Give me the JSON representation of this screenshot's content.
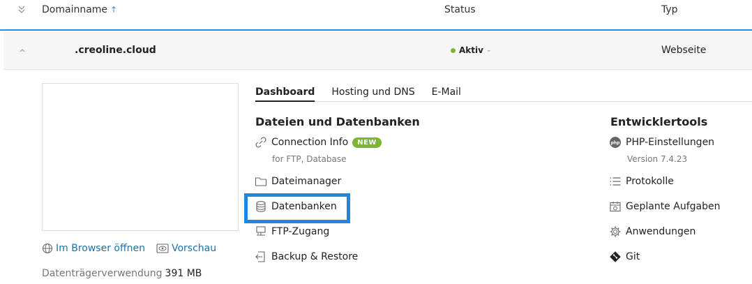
{
  "table": {
    "headers": {
      "domain": "Domainname",
      "status": "Status",
      "type": "Typ"
    }
  },
  "domain_row": {
    "name": ".creoline.cloud",
    "status": "Aktiv",
    "type": "Webseite"
  },
  "preview": {
    "open_browser": "Im Browser öffnen",
    "preview": "Vorschau",
    "disk_usage_label": "Datenträgerverwendung",
    "disk_usage_value": "391 MB"
  },
  "tabs": [
    {
      "label": "Dashboard",
      "active": true
    },
    {
      "label": "Hosting und DNS",
      "active": false
    },
    {
      "label": "E-Mail",
      "active": false
    }
  ],
  "files_section": {
    "title": "Dateien und Datenbanken",
    "connection_info": "Connection Info",
    "connection_badge": "NEW",
    "connection_sub": "for FTP, Database",
    "file_manager": "Dateimanager",
    "databases": "Datenbanken",
    "ftp": "FTP-Zugang",
    "backup": "Backup & Restore"
  },
  "dev_section": {
    "title": "Entwicklertools",
    "php": "PHP-Einstellungen",
    "php_sub": "Version 7.4.23",
    "logs": "Protokolle",
    "scheduled": "Geplante Aufgaben",
    "apps": "Anwendungen",
    "git": "Git"
  },
  "icons": {
    "expand_all": "double-chevron-down-icon",
    "sort": "arrow-up-icon",
    "collapse": "chevron-up-icon",
    "connection": "link-icon",
    "file_manager": "folder-icon",
    "databases": "database-icon",
    "ftp": "network-icon",
    "backup": "backup-icon",
    "php": "php-icon",
    "logs": "list-icon",
    "scheduled": "calendar-icon",
    "apps": "gear-icon",
    "git": "git-icon",
    "globe": "globe-icon",
    "eye": "eye-icon"
  },
  "colors": {
    "accent": "#2b8fd6",
    "link": "#1a73a8",
    "active_status": "#7cb534",
    "highlight": "#1e86e0"
  }
}
